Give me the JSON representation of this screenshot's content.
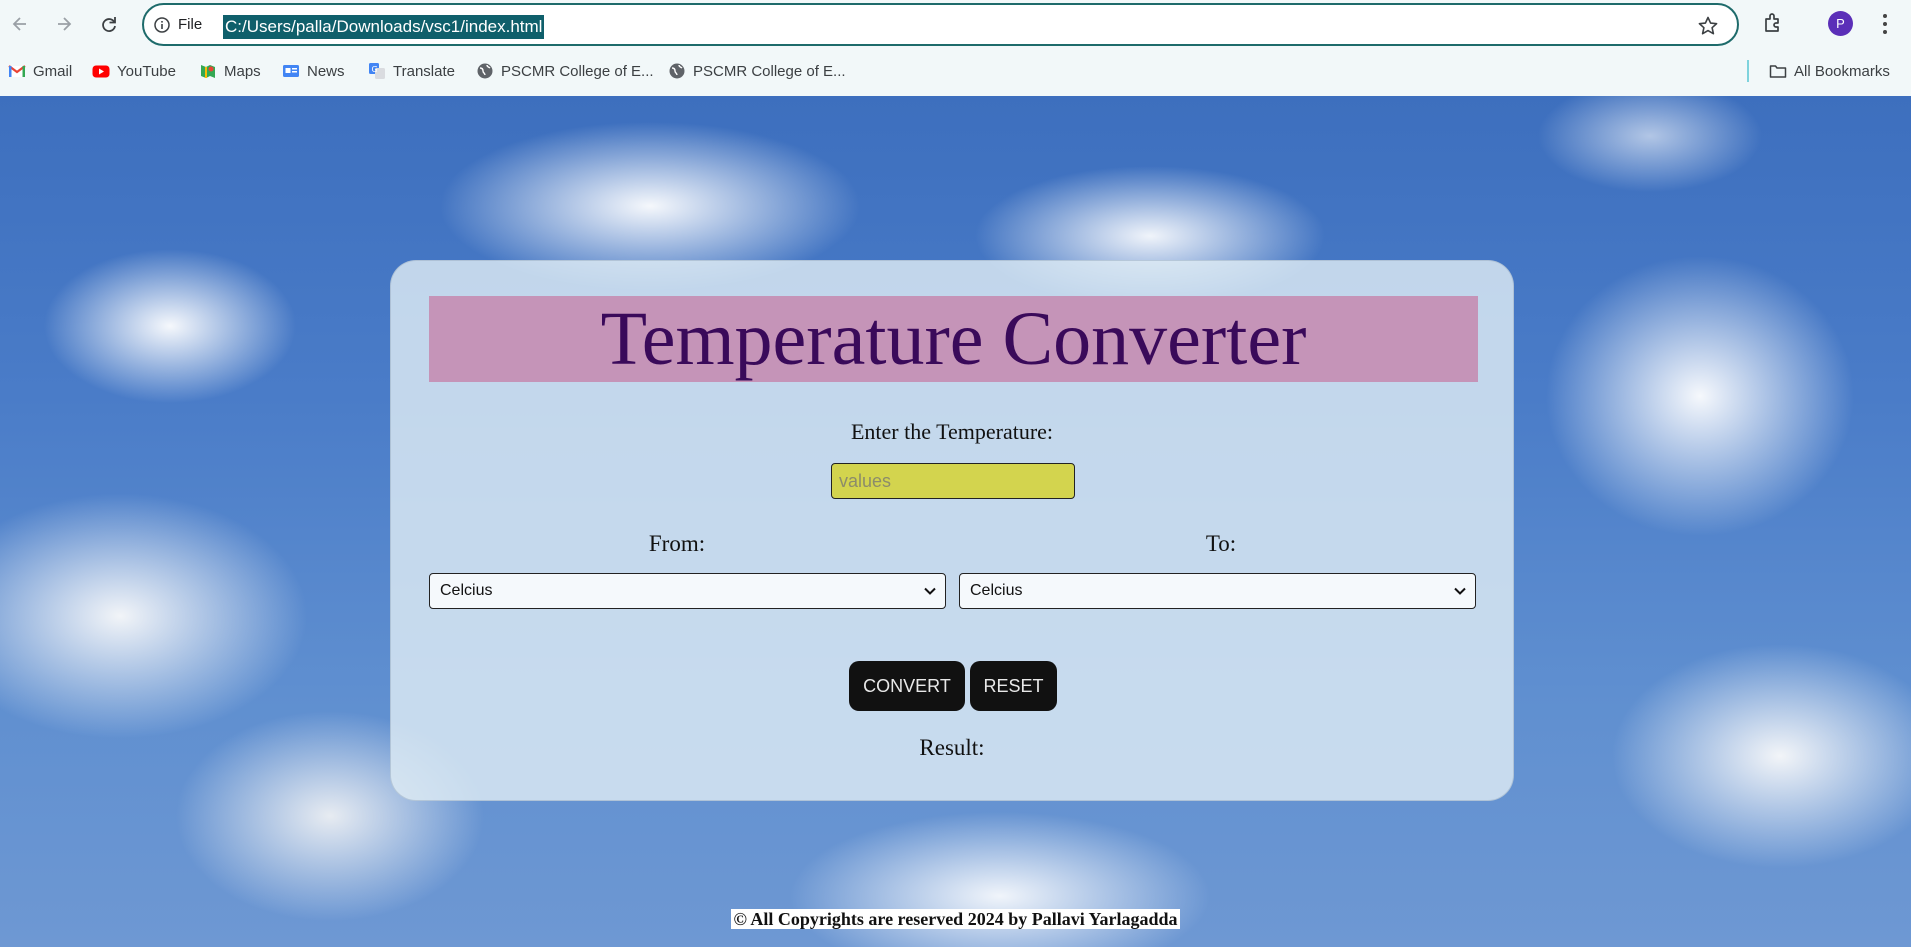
{
  "browser": {
    "address_bar": {
      "security_label": "File",
      "url": "C:/Users/palla/Downloads/vsc1/index.html"
    },
    "profile_initial": "P",
    "bookmarks": [
      {
        "label": "Gmail",
        "icon": "gmail-icon"
      },
      {
        "label": "YouTube",
        "icon": "youtube-icon"
      },
      {
        "label": "Maps",
        "icon": "maps-icon"
      },
      {
        "label": "News",
        "icon": "news-icon"
      },
      {
        "label": "Translate",
        "icon": "translate-icon"
      },
      {
        "label": "PSCMR College of E...",
        "icon": "globe-icon"
      },
      {
        "label": "PSCMR College of E...",
        "icon": "globe-icon"
      }
    ],
    "all_bookmarks_label": "All Bookmarks"
  },
  "page": {
    "title": "Temperature Converter",
    "enter_label": "Enter the Temperature:",
    "input_placeholder": "values",
    "from_label": "From:",
    "to_label": "To:",
    "from_value": "Celcius",
    "to_value": "Celcius",
    "convert_label": "CONVERT",
    "reset_label": "RESET",
    "result_label": "Result:",
    "footer": "© All Copyrights are reserved 2024 by Pallavi Yarlagadda"
  },
  "colors": {
    "title_bg": "#c594b8",
    "title_text": "#3a0a5a",
    "input_bg": "#d3d44e",
    "button_bg": "#111111",
    "url_highlight": "#0f5f6b"
  }
}
